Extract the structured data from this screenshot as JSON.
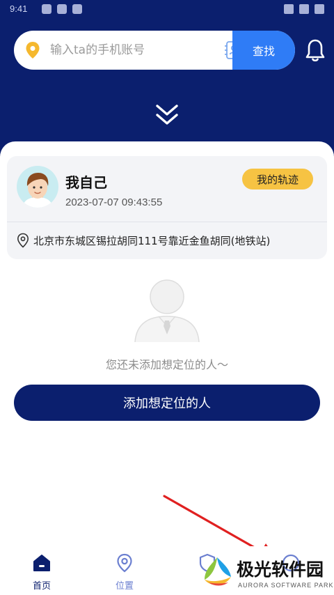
{
  "status_bar": {
    "time": "9:41"
  },
  "search": {
    "placeholder": "输入ta的手机账号",
    "button_label": "查找"
  },
  "self_card": {
    "name": "我自己",
    "timestamp": "2023-07-07 09:43:55",
    "track_button_label": "我的轨迹",
    "address": "北京市东城区锡拉胡同111号靠近金鱼胡同(地铁站)"
  },
  "empty_state": {
    "message": "您还未添加想定位的人～"
  },
  "add_button_label": "添加想定位的人",
  "tabbar": {
    "items": [
      {
        "label": "首页",
        "icon": "home-icon"
      },
      {
        "label": "位置",
        "icon": "location-pin-icon"
      },
      {
        "label": "",
        "icon": "shield-icon"
      },
      {
        "label": "",
        "icon": "profile-icon"
      }
    ]
  },
  "watermark": {
    "title": "极光软件园",
    "subtitle": "AURORA SOFTWARE PARK"
  },
  "colors": {
    "header_bg": "#0b1f6e",
    "search_button": "#2f7cf6",
    "track_button": "#f6c343",
    "annotation_arrow": "#e02020"
  }
}
